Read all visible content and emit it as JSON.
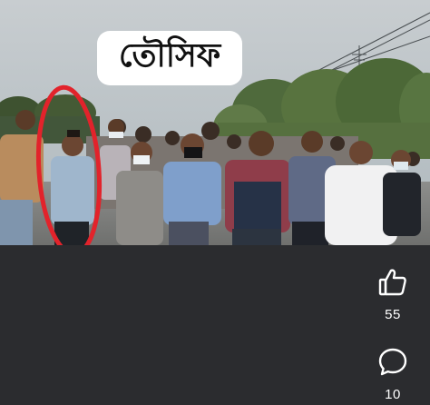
{
  "video": {
    "caption": "তৌসিফ",
    "highlight_color": "#e2232b"
  },
  "actions": {
    "like": {
      "icon": "thumbs-up-icon",
      "count": "55"
    },
    "comment": {
      "icon": "speech-bubble-icon",
      "count": "10"
    }
  },
  "colors": {
    "background": "#2a2b2e",
    "icon": "#ffffff"
  }
}
